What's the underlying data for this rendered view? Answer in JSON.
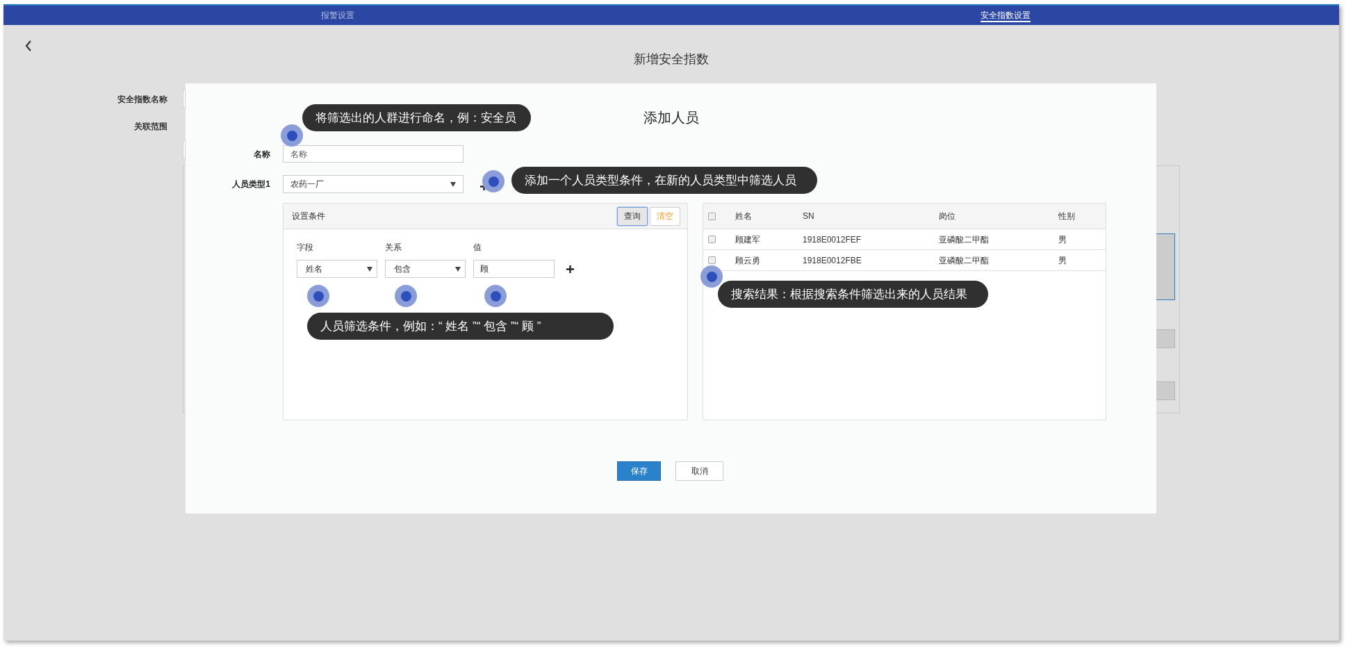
{
  "tabs": [
    {
      "label": "报警设置",
      "selected": false
    },
    {
      "label": "安全指数设置",
      "selected": true
    }
  ],
  "page_title": "新增安全指数",
  "background_form": {
    "labels": [
      "安全指数名称",
      "关联范围"
    ]
  },
  "dialog": {
    "title": "添加人员",
    "name_field": {
      "label": "名称",
      "placeholder": "名称"
    },
    "type_field": {
      "label": "人员类型1",
      "value": "农药一厂"
    },
    "conditions_panel": {
      "title": "设置条件",
      "buttons": [
        {
          "label": "查询",
          "kind": "query",
          "focused": true
        },
        {
          "label": "清空",
          "kind": "clear",
          "focused": false
        }
      ],
      "columns": [
        "字段",
        "关系",
        "值"
      ],
      "conditions": [
        {
          "field": "姓名",
          "relation": "包含",
          "value": "顾"
        }
      ]
    },
    "results": {
      "all_checked": false,
      "columns": [
        "姓名",
        "SN",
        "岗位",
        "性别"
      ],
      "rows": [
        {
          "checked": false,
          "cells": [
            "顾建军",
            "1918E0012FEF",
            "亚磷酸二甲酯",
            "男"
          ]
        },
        {
          "checked": false,
          "cells": [
            "顾云勇",
            "1918E0012FBE",
            "亚磷酸二甲酯",
            "男"
          ]
        }
      ]
    },
    "buttons": [
      {
        "label": "保存",
        "kind": "primary"
      },
      {
        "label": "取消",
        "kind": "default"
      }
    ]
  },
  "guides": [
    {
      "text": "将筛选出的人群进行命名，例：安全员"
    },
    {
      "text": "添加一个人员类型条件，在新的人员类型中筛选人员"
    },
    {
      "text": "人员筛选条件，例如：“ 姓名 ”“ 包含 ”“ 顾 ”"
    },
    {
      "text": "搜索结果：根据搜索条件筛选出来的人员结果"
    }
  ]
}
